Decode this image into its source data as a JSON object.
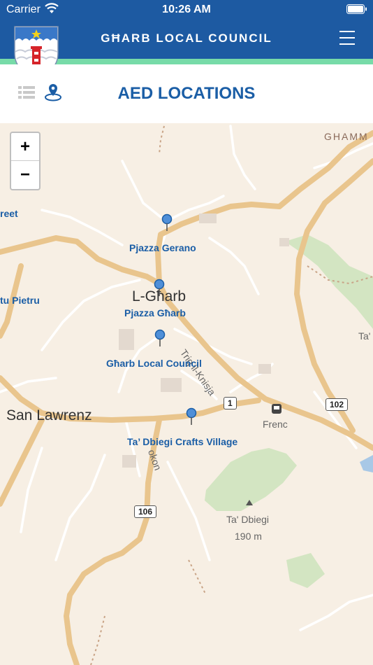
{
  "status": {
    "carrier": "Carrier",
    "time": "10:26 AM"
  },
  "header": {
    "title": "GĦARB LOCAL COUNCIL"
  },
  "page": {
    "title": "AED LOCATIONS"
  },
  "zoom": {
    "in": "+",
    "out": "−"
  },
  "colors": {
    "header": "#1d5aa2",
    "accent_stripe": "#77dba8",
    "title_blue": "#1b5ea6"
  },
  "map": {
    "places": {
      "gharb": "L-Għarb",
      "san_lawrenz": "San Lawrenz",
      "ghammar": "GHAMM",
      "tal_partial": "Ta'",
      "street_partial": "reet",
      "pietru_partial": "tu Pietru",
      "frenc": "Frenc",
      "ta_dbiegi_peak": "Ta' Dbiegi",
      "elevation": "190 m"
    },
    "roads": {
      "triq_il_knisja": "Triq il-Knisja",
      "rokon_partial": "okon"
    },
    "shields": {
      "r1": "1",
      "r102": "102",
      "r106": "106"
    },
    "markers": [
      {
        "label": "Pjazza Gerano"
      },
      {
        "label": "Pjazza Għarb"
      },
      {
        "label": "Għarb Local Council"
      },
      {
        "label": "Ta’ Dbiegi Crafts Village"
      }
    ]
  }
}
